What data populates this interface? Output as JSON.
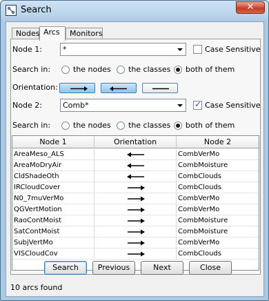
{
  "window": {
    "title": "Search",
    "close_label": "✕"
  },
  "tabs": [
    {
      "label": "Nodes",
      "active": false
    },
    {
      "label": "Arcs",
      "active": true
    },
    {
      "label": "Monitors",
      "active": false
    }
  ],
  "node1": {
    "label": "Node 1:",
    "value": "*",
    "case_sensitive_label": "Case Sensitive",
    "case_sensitive": false
  },
  "search_in_1": {
    "label": "Search in:",
    "options": [
      "the nodes",
      "the classes",
      "both of them"
    ],
    "selected": "both of them"
  },
  "orientation": {
    "label": "Orientation:",
    "options": [
      "right-arrow",
      "left-arrow",
      "line"
    ],
    "selected": [
      "right-arrow",
      "left-arrow"
    ]
  },
  "node2": {
    "label": "Node 2:",
    "value": "Comb*",
    "case_sensitive_label": "Case Sensitive",
    "case_sensitive": true
  },
  "search_in_2": {
    "label": "Search in:",
    "options": [
      "the nodes",
      "the classes",
      "both of them"
    ],
    "selected": "both of them"
  },
  "table": {
    "columns": [
      "Node 1",
      "Orientation",
      "Node 2"
    ],
    "rows": [
      {
        "node1": "AreaMeso_ALS",
        "orientation": "left",
        "node2": "CombVerMo"
      },
      {
        "node1": "AreaMoDryAir",
        "orientation": "left",
        "node2": "CombMoisture"
      },
      {
        "node1": "CldShadeOth",
        "orientation": "left",
        "node2": "CombClouds"
      },
      {
        "node1": "IRCloudCover",
        "orientation": "right",
        "node2": "CombClouds"
      },
      {
        "node1": "N0_7muVerMo",
        "orientation": "right",
        "node2": "CombVerMo"
      },
      {
        "node1": "QGVertMotion",
        "orientation": "right",
        "node2": "CombVerMo"
      },
      {
        "node1": "RaoContMoist",
        "orientation": "right",
        "node2": "CombMoisture"
      },
      {
        "node1": "SatContMoist",
        "orientation": "right",
        "node2": "CombMoisture"
      },
      {
        "node1": "SubjVertMo",
        "orientation": "right",
        "node2": "CombVerMo"
      },
      {
        "node1": "VISCloudCov",
        "orientation": "right",
        "node2": "CombClouds"
      }
    ]
  },
  "buttons": {
    "search": "Search",
    "previous": "Previous",
    "next": "Next",
    "close": "Close"
  },
  "status": "10 arcs found"
}
